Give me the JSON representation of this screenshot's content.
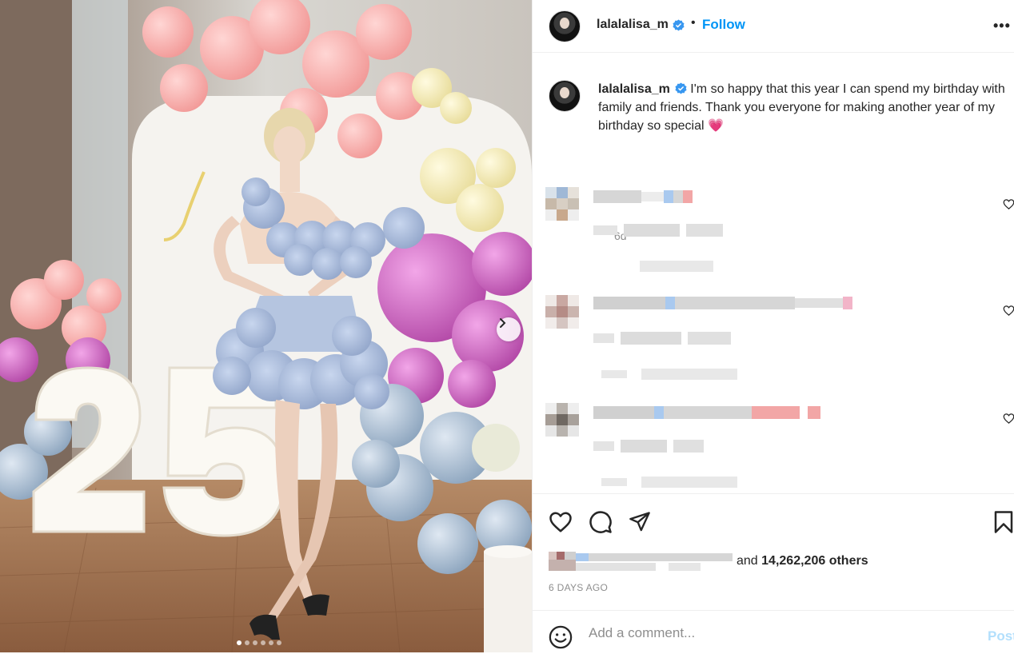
{
  "post": {
    "username": "lalalalisa_m",
    "verified": true,
    "follow_label": "Follow",
    "separator": "•",
    "more_label": "•••"
  },
  "caption": {
    "username": "lalalalisa_m",
    "text": "I'm so happy that this year I can spend my birthday with family and friends. Thank you everyone for making another year of my birthday so special",
    "emoji": "💗",
    "time": "6d"
  },
  "media": {
    "photo_number": "25",
    "carousel_dots": 6,
    "active_dot": 0
  },
  "likes": {
    "prefix": "and",
    "count": "14,262,206",
    "suffix": "others"
  },
  "posted_ago": "6 DAYS AGO",
  "comment_box": {
    "placeholder": "Add a comment...",
    "post_label": "Post"
  },
  "icons": {
    "like": "heart-icon",
    "comment": "comment-icon",
    "share": "share-icon",
    "save": "bookmark-icon",
    "emoji": "smile-icon",
    "next": "chevron-right-icon",
    "verified": "verified-badge-icon"
  },
  "colors": {
    "accent": "#0095f6",
    "verified": "#3897f0",
    "muted": "#8e8e8e",
    "post_disabled": "#b2dffc"
  }
}
